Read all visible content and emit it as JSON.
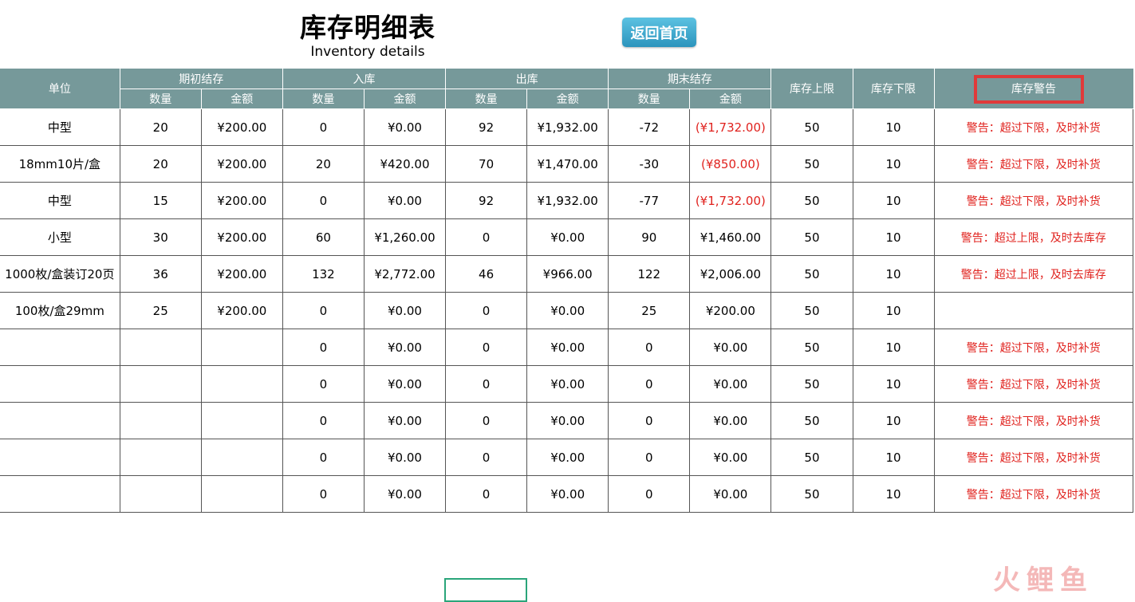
{
  "header": {
    "title": "库存明细表",
    "subtitle": "Inventory details",
    "home_button": "返回首页"
  },
  "table": {
    "group_headers": {
      "unit": "单位",
      "opening": "期初结存",
      "inbound": "入库",
      "outbound": "出库",
      "closing": "期末结存",
      "upper_limit": "库存上限",
      "lower_limit": "库存下限",
      "warning": "库存警告"
    },
    "sub_headers": {
      "qty": "数量",
      "amount": "金额"
    },
    "rows": [
      [
        "中型",
        "20",
        "¥200.00",
        "0",
        "¥0.00",
        "92",
        "¥1,932.00",
        "-72",
        "(¥1,732.00)",
        "50",
        "10",
        "警告：超过下限，及时补货"
      ],
      [
        "18mm10片/盒",
        "20",
        "¥200.00",
        "20",
        "¥420.00",
        "70",
        "¥1,470.00",
        "-30",
        "(¥850.00)",
        "50",
        "10",
        "警告：超过下限，及时补货"
      ],
      [
        "中型",
        "15",
        "¥200.00",
        "0",
        "¥0.00",
        "92",
        "¥1,932.00",
        "-77",
        "(¥1,732.00)",
        "50",
        "10",
        "警告：超过下限，及时补货"
      ],
      [
        "小型",
        "30",
        "¥200.00",
        "60",
        "¥1,260.00",
        "0",
        "¥0.00",
        "90",
        "¥1,460.00",
        "50",
        "10",
        "警告：超过上限，及时去库存"
      ],
      [
        "1000枚/盒装订20页",
        "36",
        "¥200.00",
        "132",
        "¥2,772.00",
        "46",
        "¥966.00",
        "122",
        "¥2,006.00",
        "50",
        "10",
        "警告：超过上限，及时去库存"
      ],
      [
        "100枚/盒29mm",
        "25",
        "¥200.00",
        "0",
        "¥0.00",
        "0",
        "¥0.00",
        "25",
        "¥200.00",
        "50",
        "10",
        ""
      ],
      [
        "",
        "",
        "",
        "0",
        "¥0.00",
        "0",
        "¥0.00",
        "0",
        "¥0.00",
        "50",
        "10",
        "警告：超过下限，及时补货"
      ],
      [
        "",
        "",
        "",
        "0",
        "¥0.00",
        "0",
        "¥0.00",
        "0",
        "¥0.00",
        "50",
        "10",
        "警告：超过下限，及时补货"
      ],
      [
        "",
        "",
        "",
        "0",
        "¥0.00",
        "0",
        "¥0.00",
        "0",
        "¥0.00",
        "50",
        "10",
        "警告：超过下限，及时补货"
      ],
      [
        "",
        "",
        "",
        "0",
        "¥0.00",
        "0",
        "¥0.00",
        "0",
        "¥0.00",
        "50",
        "10",
        "警告：超过下限，及时补货"
      ],
      [
        "",
        "",
        "",
        "0",
        "¥0.00",
        "0",
        "¥0.00",
        "0",
        "¥0.00",
        "50",
        "10",
        "警告：超过下限，及时补货"
      ]
    ],
    "negative_color": "#e0221e",
    "header_bg": "#76999a"
  },
  "watermark": "火鲤鱼"
}
